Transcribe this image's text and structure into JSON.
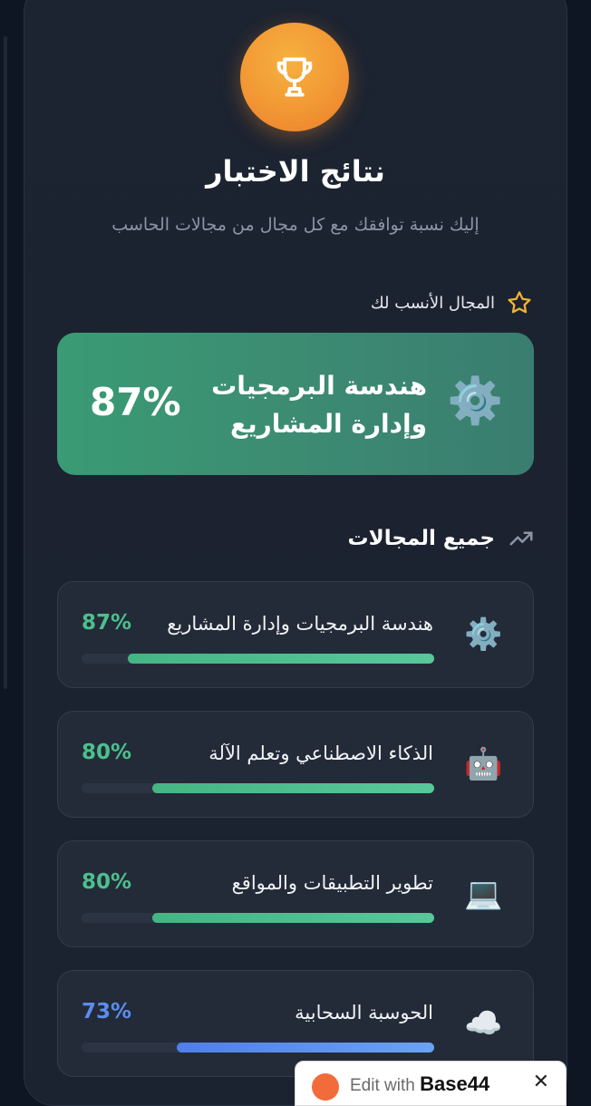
{
  "header": {
    "title": "نتائج الاختبار",
    "subtitle": "إليك نسبة توافقك مع كل مجال من مجالات الحاسب"
  },
  "best_match": {
    "label": "المجال الأنسب لك",
    "icon": "gear-icon",
    "name": "هندسة البرمجيات وإدارة المشاريع",
    "percent": "87%"
  },
  "all_fields": {
    "label": "جميع المجالات",
    "items": [
      {
        "icon": "gear-icon",
        "emoji": "⚙️",
        "name": "هندسة البرمجيات وإدارة المشاريع",
        "percent": "87%",
        "value": 0.87,
        "color": "#4cc08d"
      },
      {
        "icon": "robot-icon",
        "emoji": "🤖",
        "name": "الذكاء الاصطناعي وتعلم الآلة",
        "percent": "80%",
        "value": 0.8,
        "color": "#4cc08d"
      },
      {
        "icon": "laptop-icon",
        "emoji": "💻",
        "name": "تطوير التطبيقات والمواقع",
        "percent": "80%",
        "value": 0.8,
        "color": "#4cc08d"
      },
      {
        "icon": "cloud-icon",
        "emoji": "☁️",
        "name": "الحوسبة السحابية",
        "percent": "73%",
        "value": 0.73,
        "color": "#5b8def"
      }
    ]
  },
  "badge": {
    "prefix": "Edit with",
    "brand": "Base44",
    "close": "✕"
  },
  "colors": {
    "accent_green": "#4cc08d",
    "accent_blue": "#5b8def",
    "trophy_orange": "#f29a35"
  }
}
